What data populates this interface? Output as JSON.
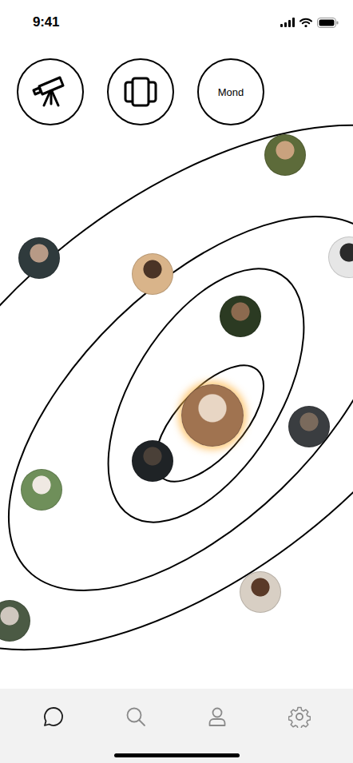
{
  "status_bar": {
    "time": "9:41"
  },
  "top_buttons": [
    {
      "kind": "telescope"
    },
    {
      "kind": "cards"
    },
    {
      "kind": "text",
      "label": "Mond"
    }
  ],
  "avatars": [
    {
      "selected": false
    },
    {
      "selected": false
    },
    {
      "selected": false
    },
    {
      "selected": false
    },
    {
      "selected": false
    },
    {
      "selected": true
    },
    {
      "selected": false
    },
    {
      "selected": false
    },
    {
      "selected": false
    },
    {
      "selected": false
    },
    {
      "selected": false
    }
  ],
  "tab_bar": [
    {
      "kind": "chat",
      "selected": true
    },
    {
      "kind": "search",
      "selected": false
    },
    {
      "kind": "profile",
      "selected": false
    },
    {
      "kind": "settings",
      "selected": false
    }
  ]
}
